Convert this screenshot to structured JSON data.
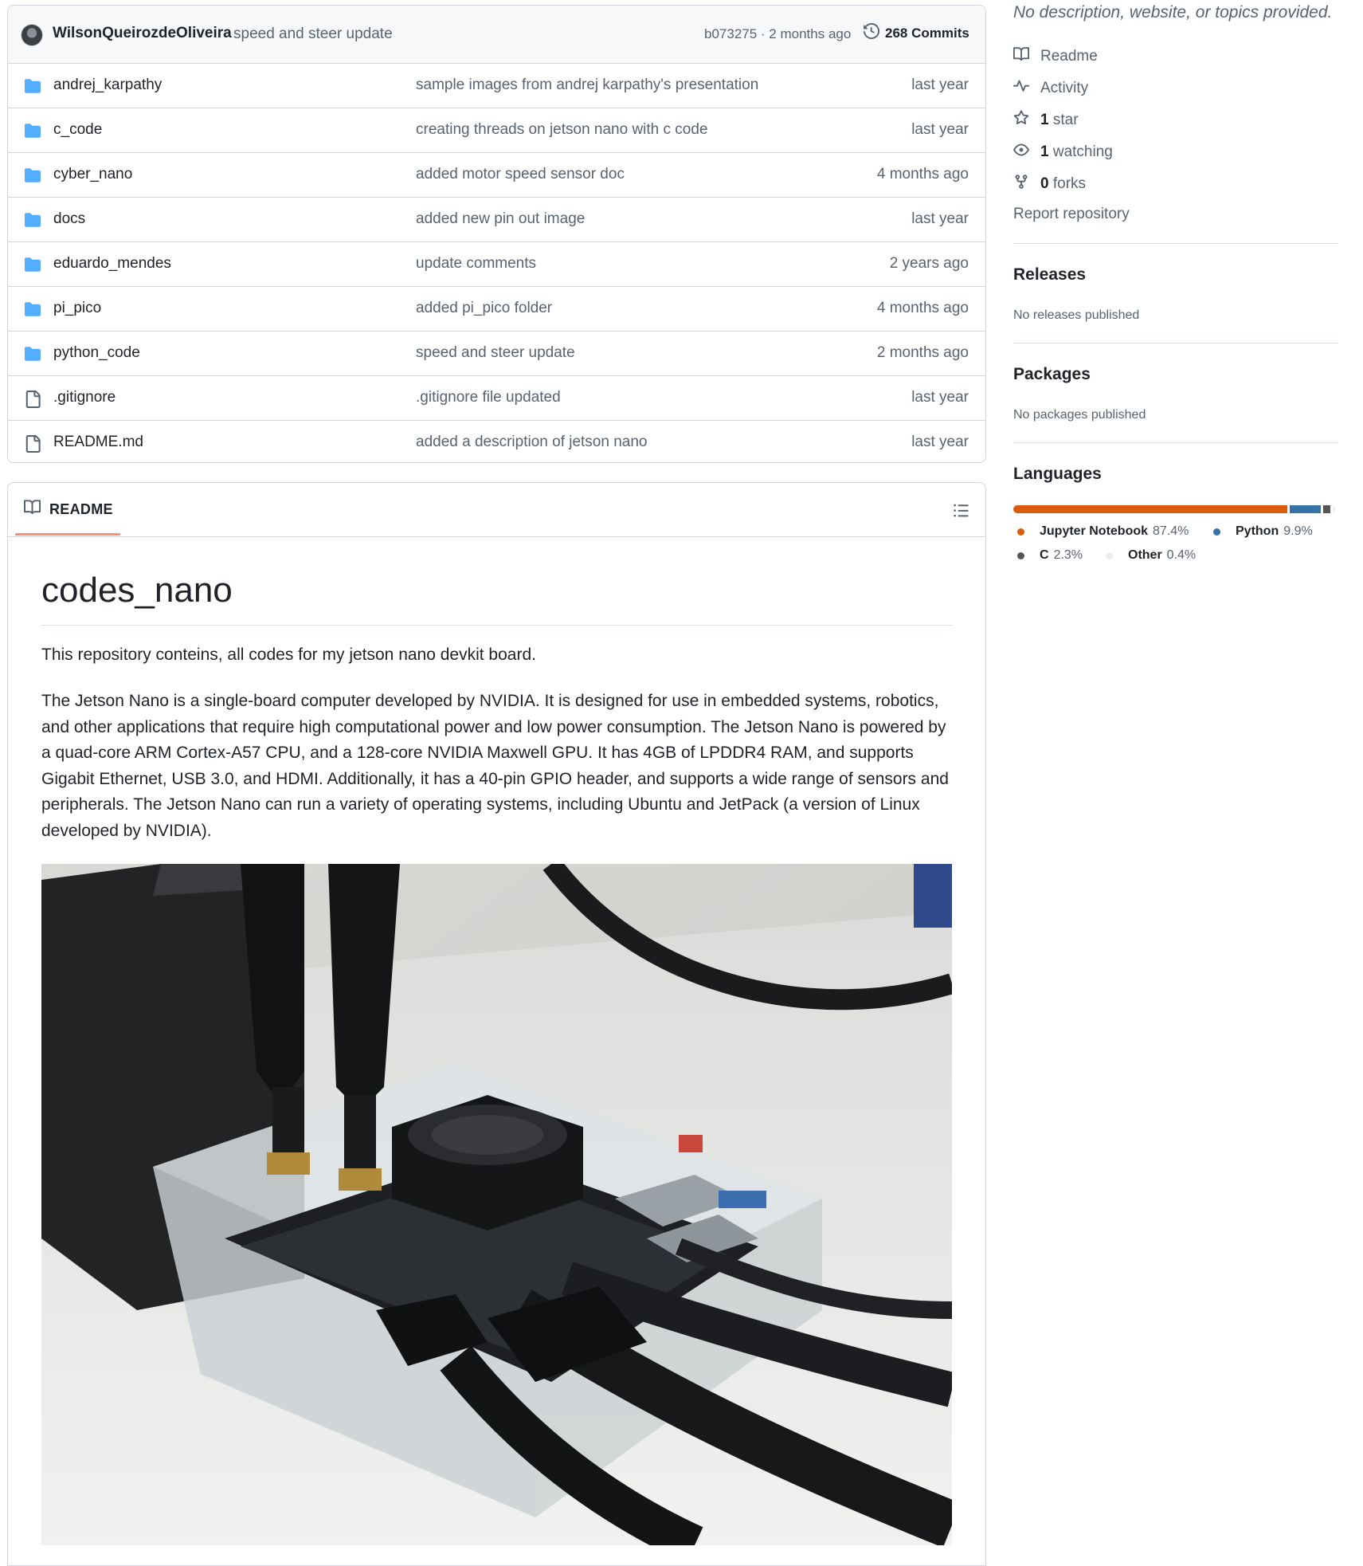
{
  "commit": {
    "author": "WilsonQueirozdeOliveira",
    "message": "speed and steer update",
    "sha_time": "b073275 · 2 months ago",
    "commits_label": "268 Commits"
  },
  "files": [
    {
      "name": "andrej_karpathy",
      "message": "sample images from andrej karpathy's presentation",
      "time": "last year",
      "type": "folder"
    },
    {
      "name": "c_code",
      "message": "creating threads on jetson nano with c code",
      "time": "last year",
      "type": "folder"
    },
    {
      "name": "cyber_nano",
      "message": "added motor speed sensor doc",
      "time": "4 months ago",
      "type": "folder"
    },
    {
      "name": "docs",
      "message": "added new pin out image",
      "time": "last year",
      "type": "folder"
    },
    {
      "name": "eduardo_mendes",
      "message": "update comments",
      "time": "2 years ago",
      "type": "folder"
    },
    {
      "name": "pi_pico",
      "message": "added pi_pico folder",
      "time": "4 months ago",
      "type": "folder"
    },
    {
      "name": "python_code",
      "message": "speed and steer update",
      "time": "2 months ago",
      "type": "folder"
    },
    {
      "name": ".gitignore",
      "message": ".gitignore file updated",
      "time": "last year",
      "type": "file"
    },
    {
      "name": "README.md",
      "message": "added a description of jetson nano",
      "time": "last year",
      "type": "file"
    }
  ],
  "readme": {
    "tab_label": "README",
    "title": "codes_nano",
    "p1": "This repository conteins, all codes for my jetson nano devkit board.",
    "p2": "The Jetson Nano is a single-board computer developed by NVIDIA. It is designed for use in embedded systems, robotics, and other applications that require high computational power and low power consumption. The Jetson Nano is powered by a quad-core ARM Cortex-A57 CPU, and a 128-core NVIDIA Maxwell GPU. It has 4GB of LPDDR4 RAM, and supports Gigabit Ethernet, USB 3.0, and HDMI. Additionally, it has a 40-pin GPIO header, and supports a wide range of sensors and peripherals. The Jetson Nano can run a variety of operating systems, including Ubuntu and JetPack (a version of Linux developed by NVIDIA)."
  },
  "sidebar": {
    "description": "No description, website, or topics provided.",
    "readme": "Readme",
    "activity": "Activity",
    "stars_count": "1",
    "stars_label": "star",
    "watching_count": "1",
    "watching_label": "watching",
    "forks_count": "0",
    "forks_label": "forks",
    "report": "Report repository",
    "releases_title": "Releases",
    "releases_text": "No releases published",
    "packages_title": "Packages",
    "packages_text": "No packages published",
    "languages_title": "Languages"
  },
  "languages": [
    {
      "name": "Jupyter Notebook",
      "percent": "87.4%",
      "value": 87.4,
      "color": "#DA5B0B"
    },
    {
      "name": "Python",
      "percent": "9.9%",
      "value": 9.9,
      "color": "#3572A5"
    },
    {
      "name": "C",
      "percent": "2.3%",
      "value": 2.3,
      "color": "#555555"
    },
    {
      "name": "Other",
      "percent": "0.4%",
      "value": 0.4,
      "color": "#ededed"
    }
  ]
}
